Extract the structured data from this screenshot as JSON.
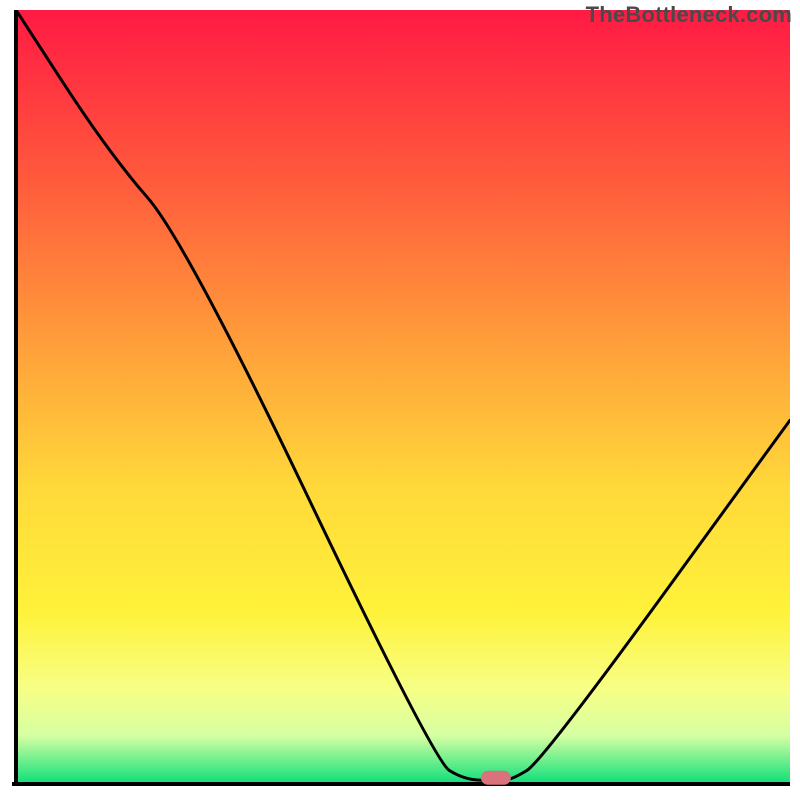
{
  "watermark": "TheBottleneck.com",
  "colors": {
    "top": "#ff1a44",
    "g1": "#ff5a3c",
    "g2": "#ffa43a",
    "g3": "#ffd93a",
    "g4": "#fff23a",
    "g5": "#f7ff86",
    "g6": "#d6ffa3",
    "bottom": "#14e07a",
    "axis": "#000000",
    "curve": "#000000",
    "marker": "#d9727a"
  },
  "chart_data": {
    "type": "line",
    "title": "",
    "xlabel": "",
    "ylabel": "",
    "xlim": [
      0,
      1000
    ],
    "ylim": [
      0,
      1000
    ],
    "series": [
      {
        "name": "bottleneck-curve",
        "x": [
          0,
          120,
          220,
          540,
          580,
          620,
          640,
          680,
          1000
        ],
        "values": [
          1000,
          815,
          700,
          30,
          5,
          5,
          5,
          30,
          470
        ]
      }
    ],
    "marker": {
      "x": 620,
      "y": 8,
      "name": "optimal-point"
    },
    "gradient_stops": [
      {
        "offset": 0.0,
        "color": "#ff1a44"
      },
      {
        "offset": 0.22,
        "color": "#ff5a3c"
      },
      {
        "offset": 0.45,
        "color": "#ffa43a"
      },
      {
        "offset": 0.62,
        "color": "#ffd93a"
      },
      {
        "offset": 0.78,
        "color": "#fff23a"
      },
      {
        "offset": 0.88,
        "color": "#f7ff86"
      },
      {
        "offset": 0.94,
        "color": "#d6ffa3"
      },
      {
        "offset": 1.0,
        "color": "#14e07a"
      }
    ],
    "axes_visible": true,
    "ticks_visible": false
  }
}
